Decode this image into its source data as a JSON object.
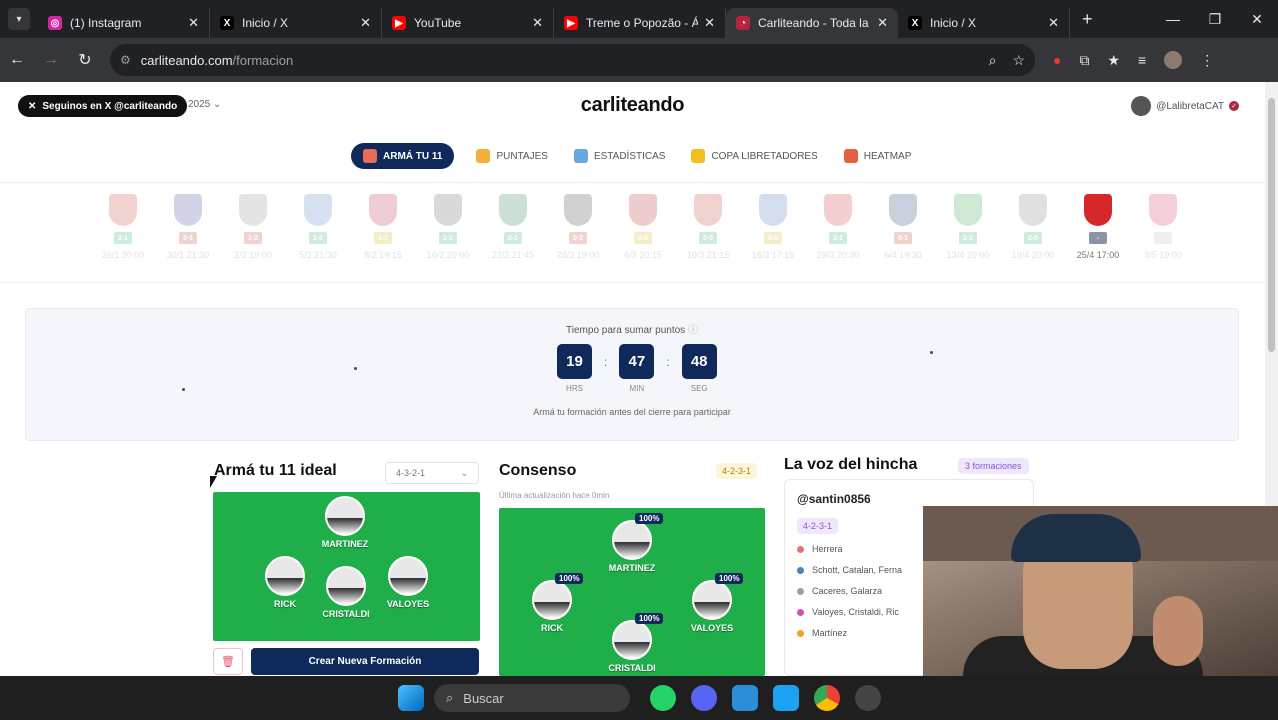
{
  "browser": {
    "tabs": [
      {
        "title": "(1) Instagram",
        "color": "#d6249f",
        "glyph": "◎"
      },
      {
        "title": "Inicio / X",
        "color": "#000000",
        "glyph": "X"
      },
      {
        "title": "YouTube",
        "color": "#ff0000",
        "glyph": "▶"
      },
      {
        "title": "Treme o Popozão - Á",
        "color": "#ff0000",
        "glyph": "▶"
      },
      {
        "title": "Carliteando - Toda la",
        "color": "#b4253b",
        "glyph": "◔"
      },
      {
        "title": "Inicio / X",
        "color": "#000000",
        "glyph": "X"
      }
    ],
    "url_host": "carliteando.com",
    "url_path": "/formacion"
  },
  "site": {
    "follow_label": "Seguinos en X @carliteando",
    "year": "2025",
    "brand": "carliteando",
    "user_handle": "@LalibretaCAT"
  },
  "menu": [
    {
      "label": "ARMÁ TU 11",
      "active": true,
      "color": "#e96b5c"
    },
    {
      "label": "PUNTAJES",
      "active": false,
      "color": "#f0b23c"
    },
    {
      "label": "ESTADÍSTICAS",
      "active": false,
      "color": "#6aa7e0"
    },
    {
      "label": "COPA LIBRETADORES",
      "active": false,
      "color": "#f2c01e"
    },
    {
      "label": "HEATMAP",
      "active": false,
      "color": "#e4613d"
    }
  ],
  "fixtures": [
    {
      "score": "2-1",
      "date": "26/1 20:00",
      "color": "#c0392b",
      "scolor": "#27ae60"
    },
    {
      "score": "2-1",
      "date": "30/1 21:30",
      "color": "#2c3e90",
      "scolor": "#c0392b"
    },
    {
      "score": "1-2",
      "date": "2/2 19:00",
      "color": "#888888",
      "scolor": "#c0392b"
    },
    {
      "score": "2-0",
      "date": "5/2 21:30",
      "color": "#4a7fc1",
      "scolor": "#27ae60"
    },
    {
      "score": "1-1",
      "date": "8/2 19:15",
      "color": "#b4253b",
      "scolor": "#d4b000"
    },
    {
      "score": "2-1",
      "date": "16/2 20:00",
      "color": "#555555",
      "scolor": "#27ae60"
    },
    {
      "score": "0-1",
      "date": "22/2 21:45",
      "color": "#1a7a3a",
      "scolor": "#27ae60"
    },
    {
      "score": "0-2",
      "date": "28/2 19:00",
      "color": "#333333",
      "scolor": "#c0392b"
    },
    {
      "score": "0-0",
      "date": "6/3 20:15",
      "color": "#b22222",
      "scolor": "#d4b000"
    },
    {
      "score": "2-0",
      "date": "10/3 21:15",
      "color": "#c0392b",
      "scolor": "#27ae60"
    },
    {
      "score": "0-0",
      "date": "16/3 17:15",
      "color": "#3b6fb6",
      "scolor": "#d4b000"
    },
    {
      "score": "2-1",
      "date": "29/3 20:30",
      "color": "#d62828",
      "scolor": "#27ae60"
    },
    {
      "score": "0-1",
      "date": "6/4 19:30",
      "color": "#0d2f6b",
      "scolor": "#c0392b"
    },
    {
      "score": "2-1",
      "date": "13/4 20:00",
      "color": "#2e9e3a",
      "scolor": "#27ae60"
    },
    {
      "score": "2-0",
      "date": "19/4 20:00",
      "color": "#777777",
      "scolor": "#27ae60"
    },
    {
      "score": "-",
      "date": "25/4 17:00",
      "color": "#d62828",
      "scolor": "#8a94a6",
      "highlight": true
    },
    {
      "score": "",
      "date": "3/5 19:00",
      "color": "#d62850",
      "scolor": "#bbbbbb"
    }
  ],
  "countdown": {
    "title": "Tiempo para sumar puntos",
    "hours": "19",
    "hours_unit": "HRS",
    "minutes": "47",
    "minutes_unit": "MIN",
    "seconds": "48",
    "seconds_unit": "SEG",
    "hint": "Armá tu formación antes del cierre para participar"
  },
  "builder": {
    "title": "Armá tu 11 ideal",
    "formation": "4-3-2-1",
    "players": [
      "MARTINEZ",
      "RICK",
      "CRISTALDI",
      "VALOYES"
    ],
    "create_label": "Crear Nueva Formación"
  },
  "consensus": {
    "title": "Consenso",
    "formation": "4-2-3-1",
    "updated": "Última actualización hace 0min",
    "players": [
      {
        "name": "MARTINEZ",
        "pct": "100%"
      },
      {
        "name": "RICK",
        "pct": "100%"
      },
      {
        "name": "VALOYES",
        "pct": "100%"
      },
      {
        "name": "CRISTALDI",
        "pct": "100%"
      }
    ]
  },
  "voice": {
    "title": "La voz del hincha",
    "count_label": "3 formaciones",
    "user": "@santin0856",
    "formation": "4-2-3-1",
    "lines": [
      {
        "text": "Herrera",
        "color": "#e57373"
      },
      {
        "text": "Schott, Catalan, Ferna",
        "color": "#4a7fc1"
      },
      {
        "text": "Caceres, Galarza",
        "color": "#9e9e9e"
      },
      {
        "text": "Valoyes, Cristaldi, Ric",
        "color": "#d64fa8"
      },
      {
        "text": "Martínez",
        "color": "#f0a030"
      }
    ]
  },
  "taskbar": {
    "search_placeholder": "Buscar"
  }
}
